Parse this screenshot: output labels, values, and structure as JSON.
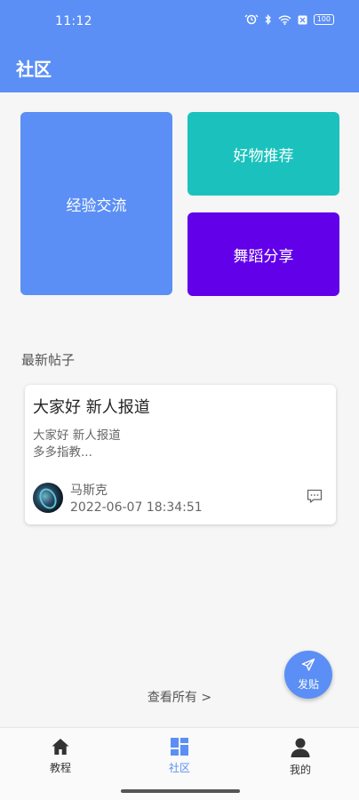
{
  "status_bar": {
    "time": "11:12",
    "battery": "100"
  },
  "app_bar": {
    "title": "社区"
  },
  "categories": [
    {
      "label": "经验交流",
      "color": "#5b8ff5"
    },
    {
      "label": "好物推荐",
      "color": "#1bc2bd"
    },
    {
      "label": "舞蹈分享",
      "color": "#6200ea"
    }
  ],
  "latest": {
    "section_title": "最新帖子",
    "posts": [
      {
        "title": "大家好 新人报道",
        "excerpt": "大家好  新人报道\n多多指教...",
        "author": "马斯克",
        "time": "2022-06-07 18:34:51"
      }
    ],
    "view_all": "查看所有 >"
  },
  "fab": {
    "label": "发贴"
  },
  "bottom_nav": [
    {
      "label": "教程",
      "icon": "home-icon",
      "active": false
    },
    {
      "label": "社区",
      "icon": "dashboard-icon",
      "active": true
    },
    {
      "label": "我的",
      "icon": "person-icon",
      "active": false
    }
  ],
  "colors": {
    "primary": "#5b8ff5",
    "teal": "#1bc2bd",
    "purple": "#6200ea"
  }
}
